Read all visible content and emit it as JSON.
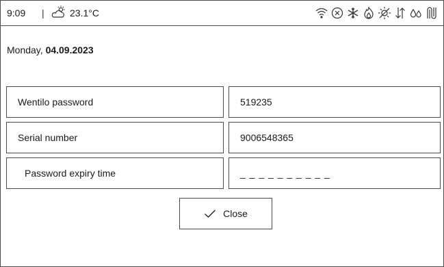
{
  "status": {
    "time": "9:09",
    "separator": "|",
    "temperature": "23.1°C",
    "weather_icon": "partly-sunny-icon",
    "icons": [
      "wifi-icon",
      "cancel-circle-icon",
      "snowflake-icon",
      "flame-icon",
      "sun-off-icon",
      "exchange-arrows-icon",
      "water-drops-icon",
      "heating-pipe-icon"
    ]
  },
  "date": {
    "weekday": "Monday,",
    "date": "04.09.2023"
  },
  "rows": [
    {
      "label": "Wentilo password",
      "value": "519235"
    },
    {
      "label": "Serial number",
      "value": "9006548365"
    },
    {
      "label": "Password expiry time",
      "value": "_ _ _ _ _ _ _ _ _ _"
    }
  ],
  "close_button": {
    "label": "Close",
    "icon": "checkmark-icon"
  }
}
